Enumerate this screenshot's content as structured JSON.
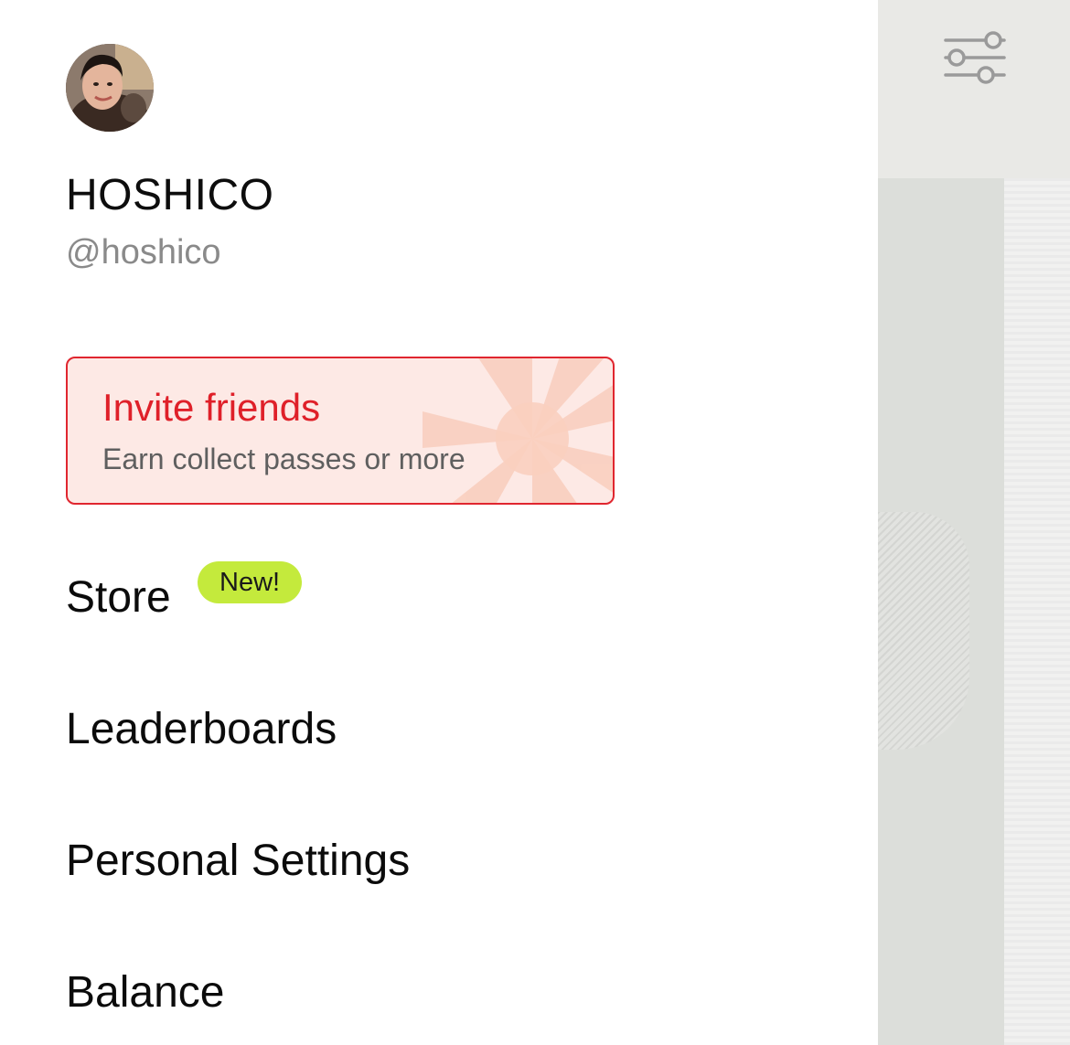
{
  "profile": {
    "name": "HOSHICO",
    "handle": "@hoshico"
  },
  "invite": {
    "title": "Invite friends",
    "subtitle": "Earn collect passes or more"
  },
  "menu": {
    "store": "Store",
    "store_badge": "New!",
    "leaderboards": "Leaderboards",
    "personal_settings": "Personal Settings",
    "balance": "Balance"
  },
  "icons": {
    "filter": "sliders-icon",
    "avatar": "avatar"
  },
  "colors": {
    "accent_red": "#e0262f",
    "invite_bg": "#fde9e5",
    "badge_green": "#c4ea3c",
    "handle_gray": "#8a8a8a"
  }
}
